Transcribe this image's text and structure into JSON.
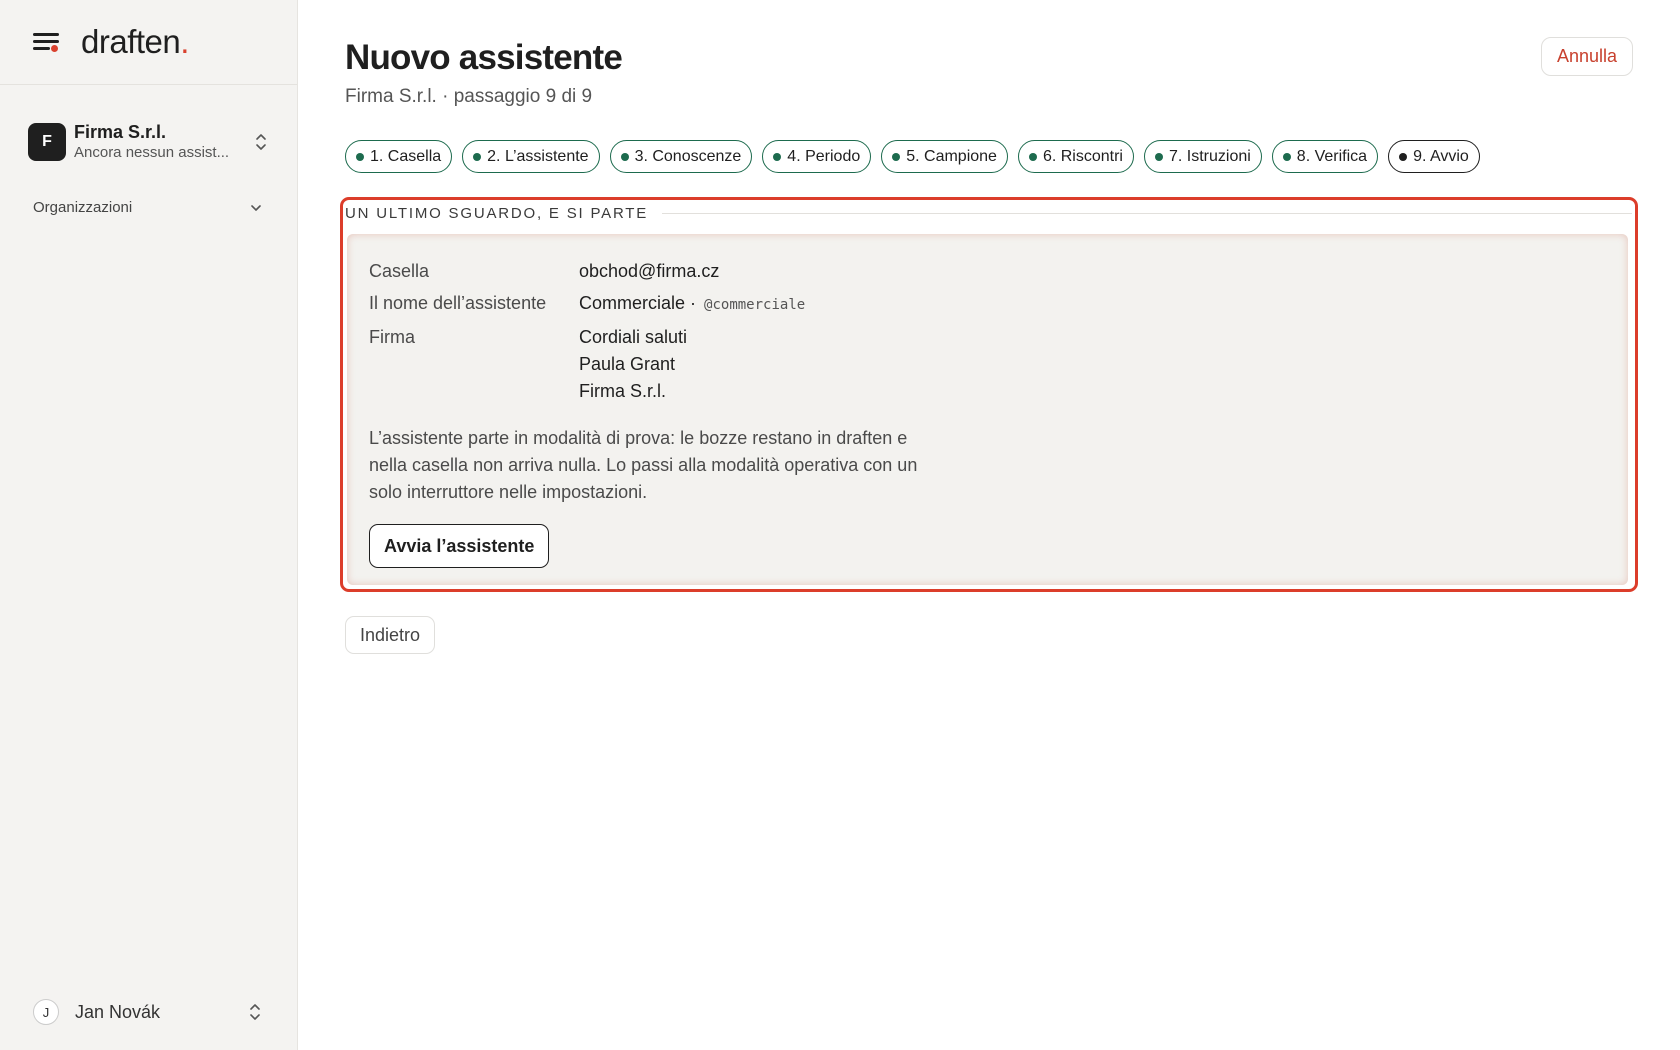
{
  "app": {
    "logo_text": "draften",
    "logo_dot": ".",
    "accent_color": "#d9412e",
    "success_color": "#1d6b4e"
  },
  "sidebar": {
    "org": {
      "avatar_letter": "F",
      "name": "Firma S.r.l.",
      "subtitle": "Ancora nessun assist..."
    },
    "section_label": "Organizzazioni",
    "user": {
      "initial": "J",
      "name": "Jan Novák"
    }
  },
  "header": {
    "title": "Nuovo assistente",
    "subtitle": "Firma S.r.l. · passaggio 9 di 9",
    "cancel_label": "Annulla"
  },
  "steps": [
    {
      "label": "1. Casella",
      "status": "done"
    },
    {
      "label": "2. L’assistente",
      "status": "done"
    },
    {
      "label": "3. Conoscenze",
      "status": "done"
    },
    {
      "label": "4. Periodo",
      "status": "done"
    },
    {
      "label": "5. Campione",
      "status": "done"
    },
    {
      "label": "6. Riscontri",
      "status": "done"
    },
    {
      "label": "7. Istruzioni",
      "status": "done"
    },
    {
      "label": "8. Verifica",
      "status": "done"
    },
    {
      "label": "9. Avvio",
      "status": "current"
    }
  ],
  "review": {
    "section_title": "UN ULTIMO SGUARDO, E SI PARTE",
    "mailbox_label": "Casella",
    "mailbox_value": "obchod@firma.cz",
    "name_label": "Il nome dell’assistente",
    "name_value": "Commerciale ·",
    "name_handle": "@commerciale",
    "signature_label": "Firma",
    "signature_lines": [
      "Cordiali saluti",
      "Paula Grant",
      "Firma S.r.l."
    ],
    "description": "L’assistente parte in modalità di prova: le bozze restano in draften e nella casella non arriva nulla. Lo passi alla modalità operativa con un solo interruttore nelle impostazioni.",
    "start_label": "Avvia l’assistente"
  },
  "footer": {
    "back_label": "Indietro"
  }
}
